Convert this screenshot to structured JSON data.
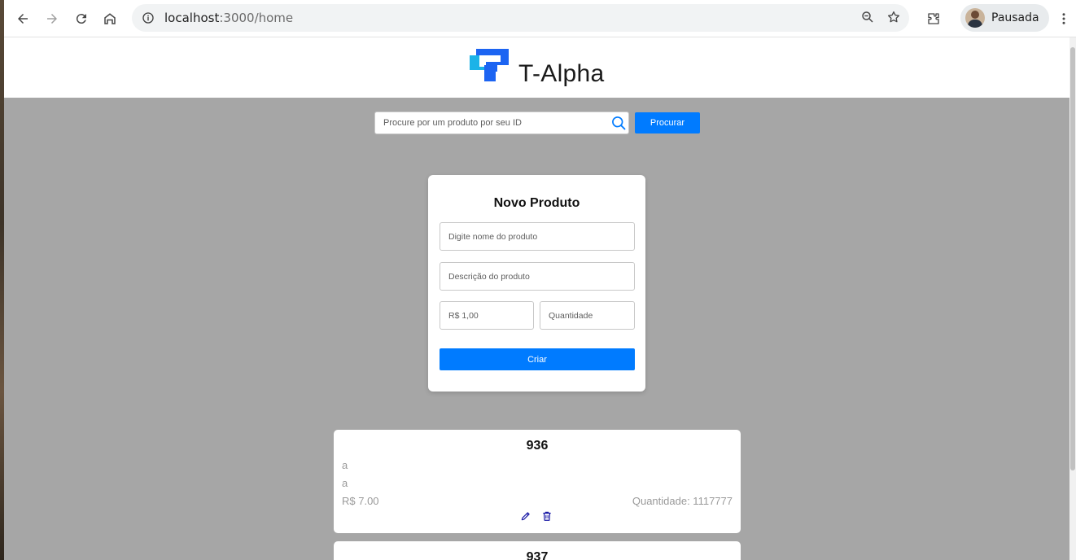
{
  "browser": {
    "url_host": "localhost",
    "url_path": ":3000/home",
    "profile_name": "Pausada"
  },
  "header": {
    "brand": "T-Alpha",
    "logo_colors": {
      "blue": "#1c64f2",
      "cyan": "#1bb3e8"
    }
  },
  "search": {
    "placeholder": "Procure por um produto por seu ID",
    "button_label": "Procurar"
  },
  "new_product_form": {
    "title": "Novo Produto",
    "name_placeholder": "Digite nome do produto",
    "description_placeholder": "Descrição do produto",
    "price_placeholder": "R$ 1,00",
    "quantity_placeholder": "Quantidade",
    "submit_label": "Criar"
  },
  "products": [
    {
      "id": "936",
      "name": "a",
      "description": "a",
      "price": "R$ 7.00",
      "quantity": "Quantidade: 1117777"
    },
    {
      "id": "937"
    }
  ],
  "colors": {
    "accent": "#007bff",
    "page_background": "#a6a6a6",
    "action_icon": "#1a1aa6"
  }
}
